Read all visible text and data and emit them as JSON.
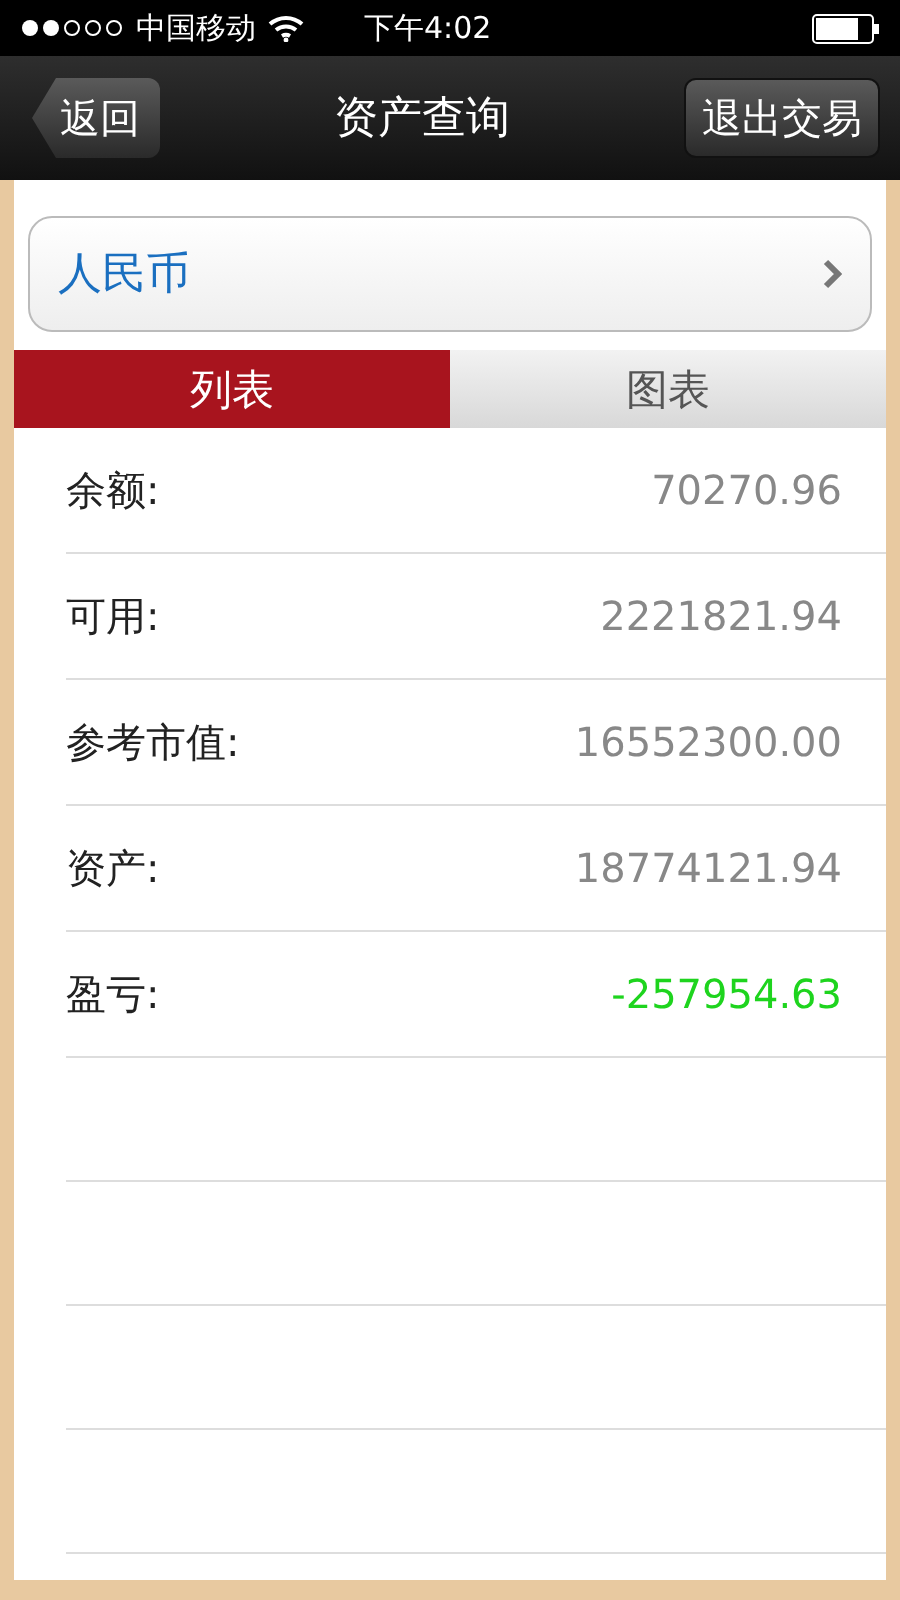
{
  "status_bar": {
    "carrier": "中国移动",
    "time": "下午4:02"
  },
  "nav": {
    "back": "返回",
    "title": "资产查询",
    "action": "退出交易"
  },
  "currency": {
    "value": "人民币"
  },
  "tabs": [
    {
      "label": "列表",
      "selected": true
    },
    {
      "label": "图表",
      "selected": false
    }
  ],
  "rows": [
    {
      "label": "余额:",
      "value": "70270.96",
      "kind": "plain"
    },
    {
      "label": "可用:",
      "value": "2221821.94",
      "kind": "plain"
    },
    {
      "label": "参考市值:",
      "value": "16552300.00",
      "kind": "plain"
    },
    {
      "label": "资产:",
      "value": "18774121.94",
      "kind": "plain"
    },
    {
      "label": "盈亏:",
      "value": "-257954.63",
      "kind": "loss"
    }
  ]
}
